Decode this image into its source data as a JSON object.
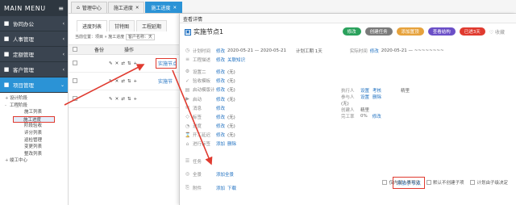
{
  "sidebar": {
    "title": "MAIN MENU",
    "burger": "≡",
    "items": [
      {
        "label": "协同办公",
        "icon": "■",
        "arrow": "‹"
      },
      {
        "label": "人事管理",
        "icon": "■",
        "arrow": "‹"
      },
      {
        "label": "定额管理",
        "icon": "■",
        "arrow": "‹"
      },
      {
        "label": "客户管理",
        "icon": "■",
        "arrow": "‹"
      },
      {
        "label": "项目管理",
        "icon": "■",
        "arrow": "⌄"
      }
    ],
    "tree": {
      "design": "设计阶段",
      "construction": "工程阶段",
      "children": [
        "施工列表",
        "施工进度",
        "阶段验收",
        "评分列表",
        "巡检管理",
        "变更列表",
        "整改列表"
      ],
      "completion": "竣工中心"
    }
  },
  "top_tabs": [
    {
      "label": "管理中心",
      "icon": "⌂"
    },
    {
      "label": "施工进度"
    },
    {
      "label": "施工进度"
    }
  ],
  "main": {
    "subtabs": [
      "进度列表",
      "甘特图",
      "工程延期"
    ],
    "crumb_prefix": "当前位置：项目 » 施工进度",
    "crumb_box": "客户名称：天",
    "columns": [
      "",
      "",
      "备份",
      "操作"
    ],
    "rows": [
      {
        "ops": [
          "✎",
          "✕",
          "⇄",
          "⇅",
          "+"
        ],
        "task": "实施节点1"
      },
      {
        "ops": [
          "✎",
          "✕",
          "⇄",
          "⇅",
          "+"
        ],
        "task": "实施节"
      },
      {
        "ops": [
          "✎",
          "✕",
          "⇄",
          "⇅",
          "+"
        ],
        "task": ""
      }
    ]
  },
  "drawer": {
    "header": "查看详情",
    "title": "实施节点1",
    "buttons": [
      {
        "label": "修改",
        "color": "#2aa15c"
      },
      {
        "label": "创建任务",
        "color": "#7a7a7a"
      },
      {
        "label": "添加置顶",
        "color": "#e6a23c"
      },
      {
        "label": "查看结构",
        "color": "#6b4fc7"
      },
      {
        "label": "已进3天",
        "color": "#e03a2f"
      }
    ],
    "fav": "♡ 收藏",
    "plan_label": "计划时间",
    "plan_edit": "修改",
    "plan_range": "2020-05-21 — 2020-05-21",
    "plan_duration": "计划工期 1天",
    "actual_label": "实际时间",
    "actual_edit": "修改",
    "actual_range": "2020-05-21 — ~~~~~~~~",
    "desc_label": "工程描述",
    "desc_edit": "修改",
    "desc_link": "关联知识",
    "fields": [
      {
        "label": "设置二",
        "edit": "修改",
        "value": "(无)"
      },
      {
        "label": "验收模板",
        "edit": "修改",
        "value": "(无)"
      },
      {
        "label": "启动模版计",
        "edit": "修改",
        "value": "(无)"
      },
      {
        "label": "启动",
        "edit": "修改",
        "value": "(无)"
      },
      {
        "label": "消息",
        "edit": "修改",
        "value": ""
      },
      {
        "label": "标签",
        "edit": "修改",
        "value": "(无)"
      },
      {
        "label": "进度",
        "edit": "修改",
        "value": "(无)"
      },
      {
        "label": "开工延迟",
        "edit": "修改",
        "value": "(无)"
      },
      {
        "label": "进行标签",
        "edit": "添加",
        "value": "删除"
      }
    ],
    "right": {
      "exec_label": "执行人",
      "exec_links": [
        "设置",
        "考核"
      ],
      "exec_value": "精里",
      "part_label": "参与人",
      "part_links": [
        "设置",
        "删除"
      ],
      "none": "(无)",
      "creator_label": "创建人",
      "creator_value": "精里",
      "progress_label": "完工率",
      "progress_value": "0%",
      "progress_edit": "修改"
    },
    "task_label": "任务",
    "subtask": "添加子节点",
    "options": [
      "仅内部人员可见",
      "默认不创建子项",
      "计划由子级决定"
    ],
    "attach_label": "全景",
    "attach_link": "添加全景",
    "file_label": "附件",
    "file_links": [
      "添加",
      "下载"
    ]
  }
}
